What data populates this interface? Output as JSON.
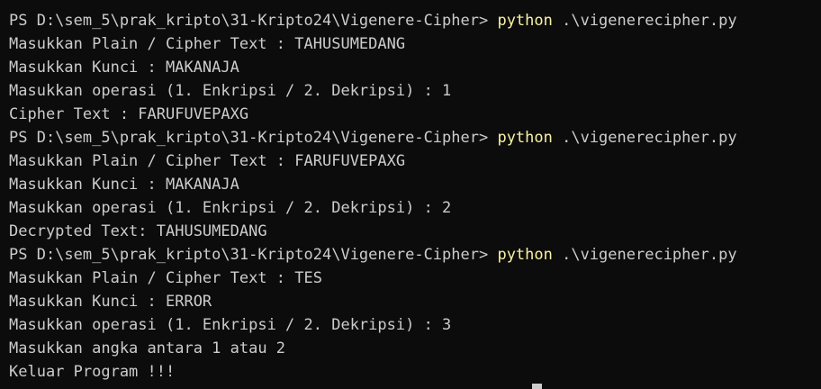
{
  "terminal": {
    "lines": [
      {
        "type": "prompt",
        "text": "PS D:\\sem_5\\prak_kripto\\31-Kripto24\\Vigenere-Cipher> ",
        "command": "python",
        "args": " .\\vigenerecipher.py"
      },
      {
        "type": "output",
        "text": "Masukkan Plain / Cipher Text : TAHUSUMEDANG"
      },
      {
        "type": "output",
        "text": "Masukkan Kunci : MAKANAJA"
      },
      {
        "type": "output",
        "text": "Masukkan operasi (1. Enkripsi / 2. Dekripsi) : 1"
      },
      {
        "type": "output",
        "text": "Cipher Text : FARUFUVEPAXG"
      },
      {
        "type": "prompt",
        "text": "PS D:\\sem_5\\prak_kripto\\31-Kripto24\\Vigenere-Cipher> ",
        "command": "python",
        "args": " .\\vigenerecipher.py"
      },
      {
        "type": "output",
        "text": "Masukkan Plain / Cipher Text : FARUFUVEPAXG"
      },
      {
        "type": "output",
        "text": "Masukkan Kunci : MAKANAJA"
      },
      {
        "type": "output",
        "text": "Masukkan operasi (1. Enkripsi / 2. Dekripsi) : 2"
      },
      {
        "type": "output",
        "text": "Decrypted Text: TAHUSUMEDANG"
      },
      {
        "type": "prompt",
        "text": "PS D:\\sem_5\\prak_kripto\\31-Kripto24\\Vigenere-Cipher> ",
        "command": "python",
        "args": " .\\vigenerecipher.py"
      },
      {
        "type": "output",
        "text": "Masukkan Plain / Cipher Text : TES"
      },
      {
        "type": "output",
        "text": "Masukkan Kunci : ERROR"
      },
      {
        "type": "output",
        "text": "Masukkan operasi (1. Enkripsi / 2. Dekripsi) : 3"
      },
      {
        "type": "output",
        "text": "Masukkan angka antara 1 atau 2"
      },
      {
        "type": "output",
        "text": "Keluar Program !!!"
      }
    ]
  },
  "colors": {
    "background": "#0c0c0c",
    "text": "#cccccc",
    "command": "#f9f1a5"
  }
}
